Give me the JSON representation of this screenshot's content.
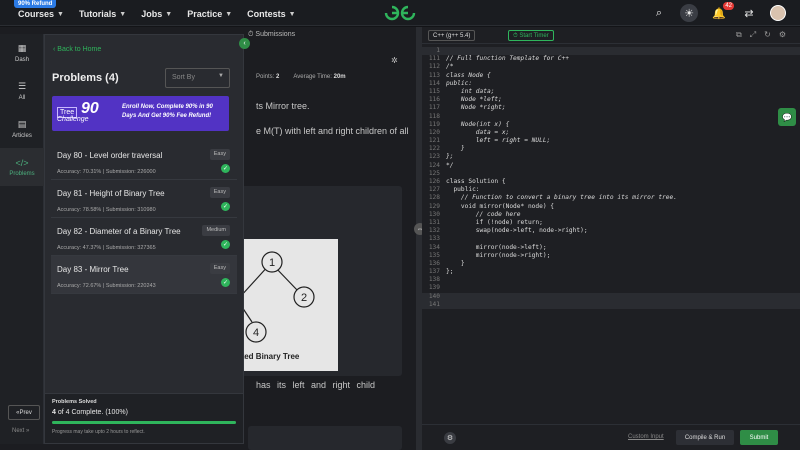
{
  "topbar": {
    "refund_badge": "90% Refund",
    "nav": [
      "Courses",
      "Tutorials",
      "Jobs",
      "Practice",
      "Contests"
    ],
    "notification_count": "42"
  },
  "problem_pane": {
    "submissions_tab": "Submissions",
    "points_label": "Points:",
    "points_value": "2",
    "avg_time_label": "Average Time:",
    "avg_time_value": "20m",
    "text1": "ts Mirror tree.",
    "text2": "e M(T) with left and right children of all",
    "text3": "has  its  left  and  right  child",
    "tree_caption": "erted Binary Tree"
  },
  "sidebar": {
    "items": [
      "Dash",
      "All",
      "Articles",
      "Problems"
    ],
    "prev": "Prev",
    "next": "Next"
  },
  "overlay": {
    "back_link": "Back to Home",
    "title": "Problems (4)",
    "sort_placeholder": "Sort By",
    "banner": {
      "logo_tree": "Tree",
      "logo_challenge": "Challenge",
      "logo_num": "90",
      "text": "Enroll Now, Complete 90% in 90 Days And Get 90% Fee Refund!"
    },
    "problems": [
      {
        "name": "Day 80 - Level order traversal",
        "difficulty": "Easy",
        "meta": "Accuracy: 70.31% | Submission: 226000"
      },
      {
        "name": "Day 81 - Height of Binary Tree",
        "difficulty": "Easy",
        "meta": "Accuracy: 78.58% | Submission: 310980"
      },
      {
        "name": "Day 82 - Diameter of a Binary Tree",
        "difficulty": "Medium",
        "meta": "Accuracy: 47.37% | Submission: 327365"
      },
      {
        "name": "Day 83 - Mirror Tree",
        "difficulty": "Easy",
        "meta": "Accuracy: 72.67% | Submission: 220243"
      }
    ],
    "solved": {
      "label": "Problems Solved",
      "count_bold": "4",
      "count_text": "of 4 Complete. (100%)",
      "progress_fraction": 1.0,
      "note": "Progress may take upto 2 hours to reflect."
    }
  },
  "editor": {
    "language": "C++ (g++ 5.4)",
    "start_timer": "Start Timer",
    "lines": [
      {
        "n": "1",
        "t": "",
        "cls": "hl"
      },
      {
        "n": "111",
        "t": "// Full function Template for C++",
        "cls": "cm"
      },
      {
        "n": "112",
        "t": "/*",
        "cls": "cm"
      },
      {
        "n": "113",
        "t": "class Node {",
        "cls": "cm"
      },
      {
        "n": "114",
        "t": "public:",
        "cls": "cm"
      },
      {
        "n": "115",
        "t": "    int data;",
        "cls": "cm"
      },
      {
        "n": "116",
        "t": "    Node *left;",
        "cls": "cm"
      },
      {
        "n": "117",
        "t": "    Node *right;",
        "cls": "cm"
      },
      {
        "n": "118",
        "t": "",
        "cls": ""
      },
      {
        "n": "119",
        "t": "    Node(int x) {",
        "cls": "cm"
      },
      {
        "n": "120",
        "t": "        data = x;",
        "cls": "cm"
      },
      {
        "n": "121",
        "t": "        left = right = NULL;",
        "cls": "cm"
      },
      {
        "n": "122",
        "t": "    }",
        "cls": "cm"
      },
      {
        "n": "123",
        "t": "};",
        "cls": "cm"
      },
      {
        "n": "124",
        "t": "*/",
        "cls": "cm"
      },
      {
        "n": "125",
        "t": "",
        "cls": ""
      },
      {
        "n": "126",
        "t": "class Solution {",
        "cls": "kw"
      },
      {
        "n": "127",
        "t": "  public:",
        "cls": "kw"
      },
      {
        "n": "128",
        "t": "    // Function to convert a binary tree into its mirror tree.",
        "cls": "cm"
      },
      {
        "n": "129",
        "t": "    void mirror(Node* node) {",
        "cls": "kw"
      },
      {
        "n": "130",
        "t": "        // code here",
        "cls": "cm"
      },
      {
        "n": "131",
        "t": "        if (!node) return;",
        "cls": "kw"
      },
      {
        "n": "132",
        "t": "        swap(node->left, node->right);",
        "cls": "kw"
      },
      {
        "n": "133",
        "t": "",
        "cls": ""
      },
      {
        "n": "134",
        "t": "        mirror(node->left);",
        "cls": "kw"
      },
      {
        "n": "135",
        "t": "        mirror(node->right);",
        "cls": "kw"
      },
      {
        "n": "136",
        "t": "    }",
        "cls": "kw"
      },
      {
        "n": "137",
        "t": "};",
        "cls": "kw"
      },
      {
        "n": "138",
        "t": "",
        "cls": ""
      },
      {
        "n": "139",
        "t": "",
        "cls": ""
      },
      {
        "n": "140",
        "t": "",
        "cls": "hl"
      },
      {
        "n": "141",
        "t": "",
        "cls": "hl"
      }
    ],
    "custom_input": "Custom Input",
    "compile_run": "Compile & Run",
    "submit": "Submit"
  },
  "colors": {
    "accent_green": "#2fb55c",
    "banner_purple": "#5233c4",
    "background": "#1e1f23"
  }
}
